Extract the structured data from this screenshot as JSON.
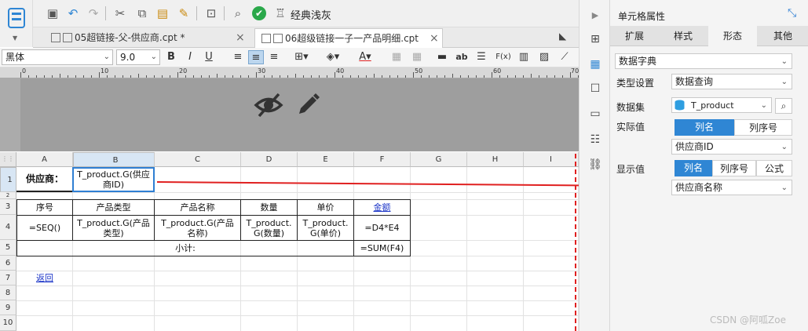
{
  "toolbar": {
    "theme_label": "经典浅灰",
    "icons": [
      "save-icon",
      "undo-icon",
      "redo-icon",
      "cut-icon",
      "copy-icon",
      "paste-icon",
      "format-brush-icon",
      "preview-icon",
      "check-icon",
      "theme-icon"
    ]
  },
  "tabs": [
    {
      "label": "05超链接-父-供应商.cpt *"
    },
    {
      "label": "06超级链接一子一产品明细.cpt"
    }
  ],
  "format": {
    "font_family": "黑体",
    "font_size": "9.0",
    "bold": "B",
    "italic": "I",
    "underline": "U",
    "text_sample": "ab",
    "fx": "F(x)"
  },
  "ruler": {
    "ticks": [
      "0",
      "10",
      "20",
      "30",
      "40",
      "50",
      "60",
      "70"
    ]
  },
  "columns": [
    "A",
    "B",
    "C",
    "D",
    "E",
    "F",
    "G",
    "H",
    "I"
  ],
  "rows": [
    "1",
    "2",
    "3",
    "4",
    "5",
    "6",
    "7",
    "8",
    "9",
    "10"
  ],
  "cells": {
    "a1": "供应商：",
    "b1": "T_product.G(供应\n商ID)",
    "a3": "序号",
    "b3": "产品类型",
    "c3": "产品名称",
    "d3": "数量",
    "e3": "单价",
    "f3": "金额",
    "a4": "=SEQ()",
    "b4": "T_product.G(产品\n类型)",
    "c4": "T_product.G(产品\n名称)",
    "d4": "T_product.\nG(数量)",
    "e4": "T_product.\nG(单价)",
    "f4": "=D4*E4",
    "merged5": "小计:",
    "f5": "=SUM(F4)",
    "a7": "返回"
  },
  "panel": {
    "title": "单元格属性",
    "tabs": [
      "扩展",
      "样式",
      "形态",
      "其他"
    ],
    "active_tab": "形态",
    "form_type": "数据字典",
    "type_setting_label": "类型设置",
    "type_setting_value": "数据查询",
    "dataset_label": "数据集",
    "dataset_value": "T_product",
    "actual_label": "实际值",
    "actual_options": [
      "列名",
      "列序号"
    ],
    "actual_value": "供应商ID",
    "display_label": "显示值",
    "display_options": [
      "列名",
      "列序号",
      "公式"
    ],
    "display_value": "供应商名称"
  },
  "watermark": "CSDN @阿呱Zoe",
  "colors": {
    "accent": "#2f86d4",
    "arrow": "#e02020",
    "link": "#1c36c8"
  }
}
